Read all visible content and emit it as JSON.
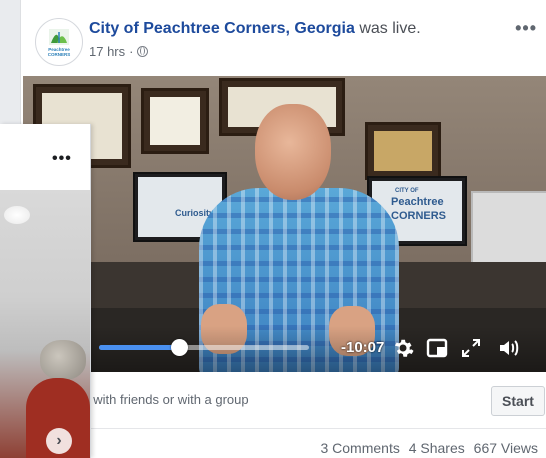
{
  "post": {
    "page_name": "City of Peachtree Corners, Georgia",
    "status_text": "was live.",
    "time_ago": "17 hrs",
    "dot": "·",
    "avatar_logo_text_top": "Peachtree",
    "avatar_logo_text_bottom": "CORNERS",
    "more_icon": "more-horizontal-icon"
  },
  "video": {
    "monitor_left_text": "Curiosity",
    "monitor_right_text_1": "CITY OF",
    "monitor_right_text_2": "Peachtree",
    "monitor_right_text_3": "CORNERS",
    "progress_fraction": 0.38,
    "time_remaining": "-10:07",
    "icons": [
      "settings-gear-icon",
      "picture-in-picture-icon",
      "fullscreen-icon",
      "volume-icon"
    ]
  },
  "watch_party": {
    "text": "tch together with friends or with a group",
    "start_label": "Start"
  },
  "stats": {
    "comments": "3 Comments",
    "shares": "4 Shares",
    "views": "667 Views"
  },
  "side_card": {
    "more_icon": "more-horizontal-icon",
    "next_icon": "chevron-right-icon",
    "next_glyph": "›"
  },
  "colors": {
    "link_blue": "#1d4a9c",
    "progress_blue": "#4a90f0"
  }
}
